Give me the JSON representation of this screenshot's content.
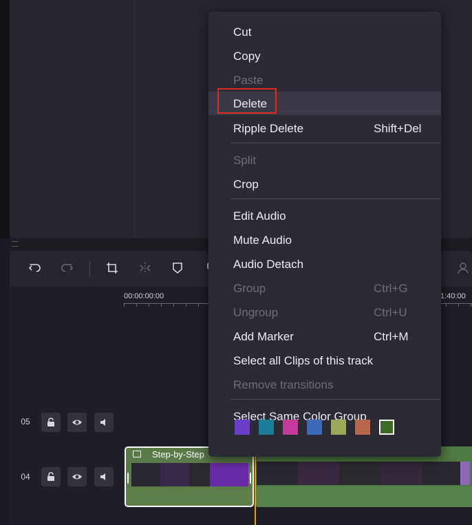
{
  "menu": {
    "items": [
      {
        "label": "Cut",
        "shortcut": "",
        "disabled": false
      },
      {
        "label": "Copy",
        "shortcut": "",
        "disabled": false
      },
      {
        "label": "Paste",
        "shortcut": "",
        "disabled": true
      },
      {
        "label": "Delete",
        "shortcut": "",
        "disabled": false
      },
      {
        "label": "Ripple Delete",
        "shortcut": "Shift+Del",
        "disabled": false
      },
      {
        "label": "Split",
        "shortcut": "",
        "disabled": true
      },
      {
        "label": "Crop",
        "shortcut": "",
        "disabled": false
      },
      {
        "label": "Edit Audio",
        "shortcut": "",
        "disabled": false
      },
      {
        "label": "Mute Audio",
        "shortcut": "",
        "disabled": false
      },
      {
        "label": "Audio Detach",
        "shortcut": "",
        "disabled": false
      },
      {
        "label": "Group",
        "shortcut": "Ctrl+G",
        "disabled": true
      },
      {
        "label": "Ungroup",
        "shortcut": "Ctrl+U",
        "disabled": true
      },
      {
        "label": "Add Marker",
        "shortcut": "Ctrl+M",
        "disabled": false
      },
      {
        "label": "Select all Clips of this track",
        "shortcut": "",
        "disabled": false
      },
      {
        "label": "Remove transitions",
        "shortcut": "",
        "disabled": true
      },
      {
        "label": "Select Same Color Group",
        "shortcut": "",
        "disabled": false
      }
    ],
    "color_swatches": [
      "#6a3ec8",
      "#1a7e96",
      "#c23a9a",
      "#3a6ab8",
      "#9aa85a",
      "#b8684a",
      "#3e6a2a"
    ]
  },
  "timeline": {
    "ruler_start": "00:00:00:00",
    "ruler_end": "1:40:00",
    "tracks": [
      {
        "number": "05"
      },
      {
        "number": "04"
      }
    ],
    "clip1_label": "Step-by-Step",
    "clip2_label": "..."
  },
  "colors": {
    "accent_highlight": "#e02a2a",
    "playhead": "#f0a000",
    "clip_green": "#5a7a48"
  }
}
